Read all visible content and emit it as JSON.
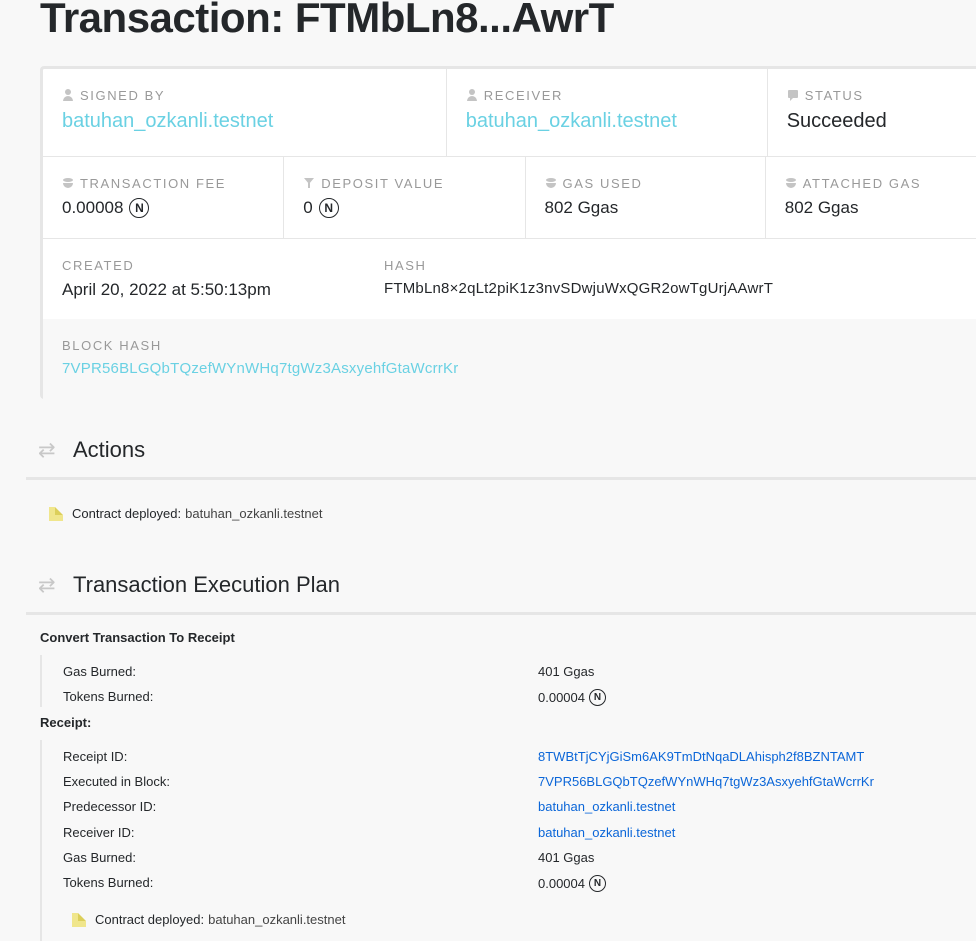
{
  "page": {
    "title": "Transaction: FTMbLn8...AwrT"
  },
  "overview": {
    "signed_by": {
      "label": "SIGNED BY",
      "value": "batuhan_ozkanli.testnet",
      "icon": "user-icon"
    },
    "receiver": {
      "label": "RECEIVER",
      "value": "batuhan_ozkanli.testnet",
      "icon": "user-icon"
    },
    "status": {
      "label": "STATUS",
      "value": "Succeeded",
      "icon": "chat-icon"
    },
    "transaction_fee": {
      "label": "TRANSACTION FEE",
      "value": "0.00008",
      "icon": "coins-icon"
    },
    "deposit_value": {
      "label": "DEPOSIT VALUE",
      "value": "0",
      "icon": "filter-icon"
    },
    "gas_used": {
      "label": "GAS USED",
      "value": "802 Ggas",
      "icon": "coins-icon"
    },
    "attached_gas": {
      "label": "ATTACHED GAS",
      "value": "802 Ggas",
      "icon": "coins-icon"
    },
    "created": {
      "label": "CREATED",
      "value": "April 20, 2022 at 5:50:13pm"
    },
    "hash": {
      "label": "HASH",
      "value": "FTMbLn8×2qLt2piK1z3nvSDwjuWxQGR2owTgUrjAAwrT"
    },
    "block_hash": {
      "label": "BLOCK HASH",
      "value": "7VPR56BLGQbTQzefWYnWHq7tgWz3AsxyehfGtaWcrrKr"
    },
    "near_symbol": "N"
  },
  "actions": {
    "heading": "Actions",
    "items": [
      {
        "kind": "Contract deployed:",
        "target": "batuhan_ozkanli.testnet"
      }
    ]
  },
  "plan": {
    "heading": "Transaction Execution Plan",
    "convert": {
      "title": "Convert Transaction To Receipt",
      "gas_burned_label": "Gas Burned:",
      "gas_burned_value": "401 Ggas",
      "tokens_burned_label": "Tokens Burned:",
      "tokens_burned_value": "0.00004"
    },
    "receipt": {
      "title": "Receipt:",
      "receipt_id_label": "Receipt ID:",
      "receipt_id_value": "8TWBtTjCYjGiSm6AK9TmDtNqaDLAhisph2f8BZNTAMT",
      "executed_label": "Executed in Block:",
      "executed_value": "7VPR56BLGQbTQzefWYnWHq7tgWz3AsxyehfGtaWcrrKr",
      "predecessor_label": "Predecessor ID:",
      "predecessor_value": "batuhan_ozkanli.testnet",
      "receiver_label": "Receiver ID:",
      "receiver_value": "batuhan_ozkanli.testnet",
      "gas_burned_label": "Gas Burned:",
      "gas_burned_value": "401 Ggas",
      "tokens_burned_label": "Tokens Burned:",
      "tokens_burned_value": "0.00004",
      "action_kind": "Contract deployed:",
      "action_target": "batuhan_ozkanli.testnet"
    }
  },
  "colors": {
    "link_cyan": "#6ad1e3",
    "link_blue": "#0b66d8",
    "text": "#24272a",
    "muted": "#999999"
  }
}
